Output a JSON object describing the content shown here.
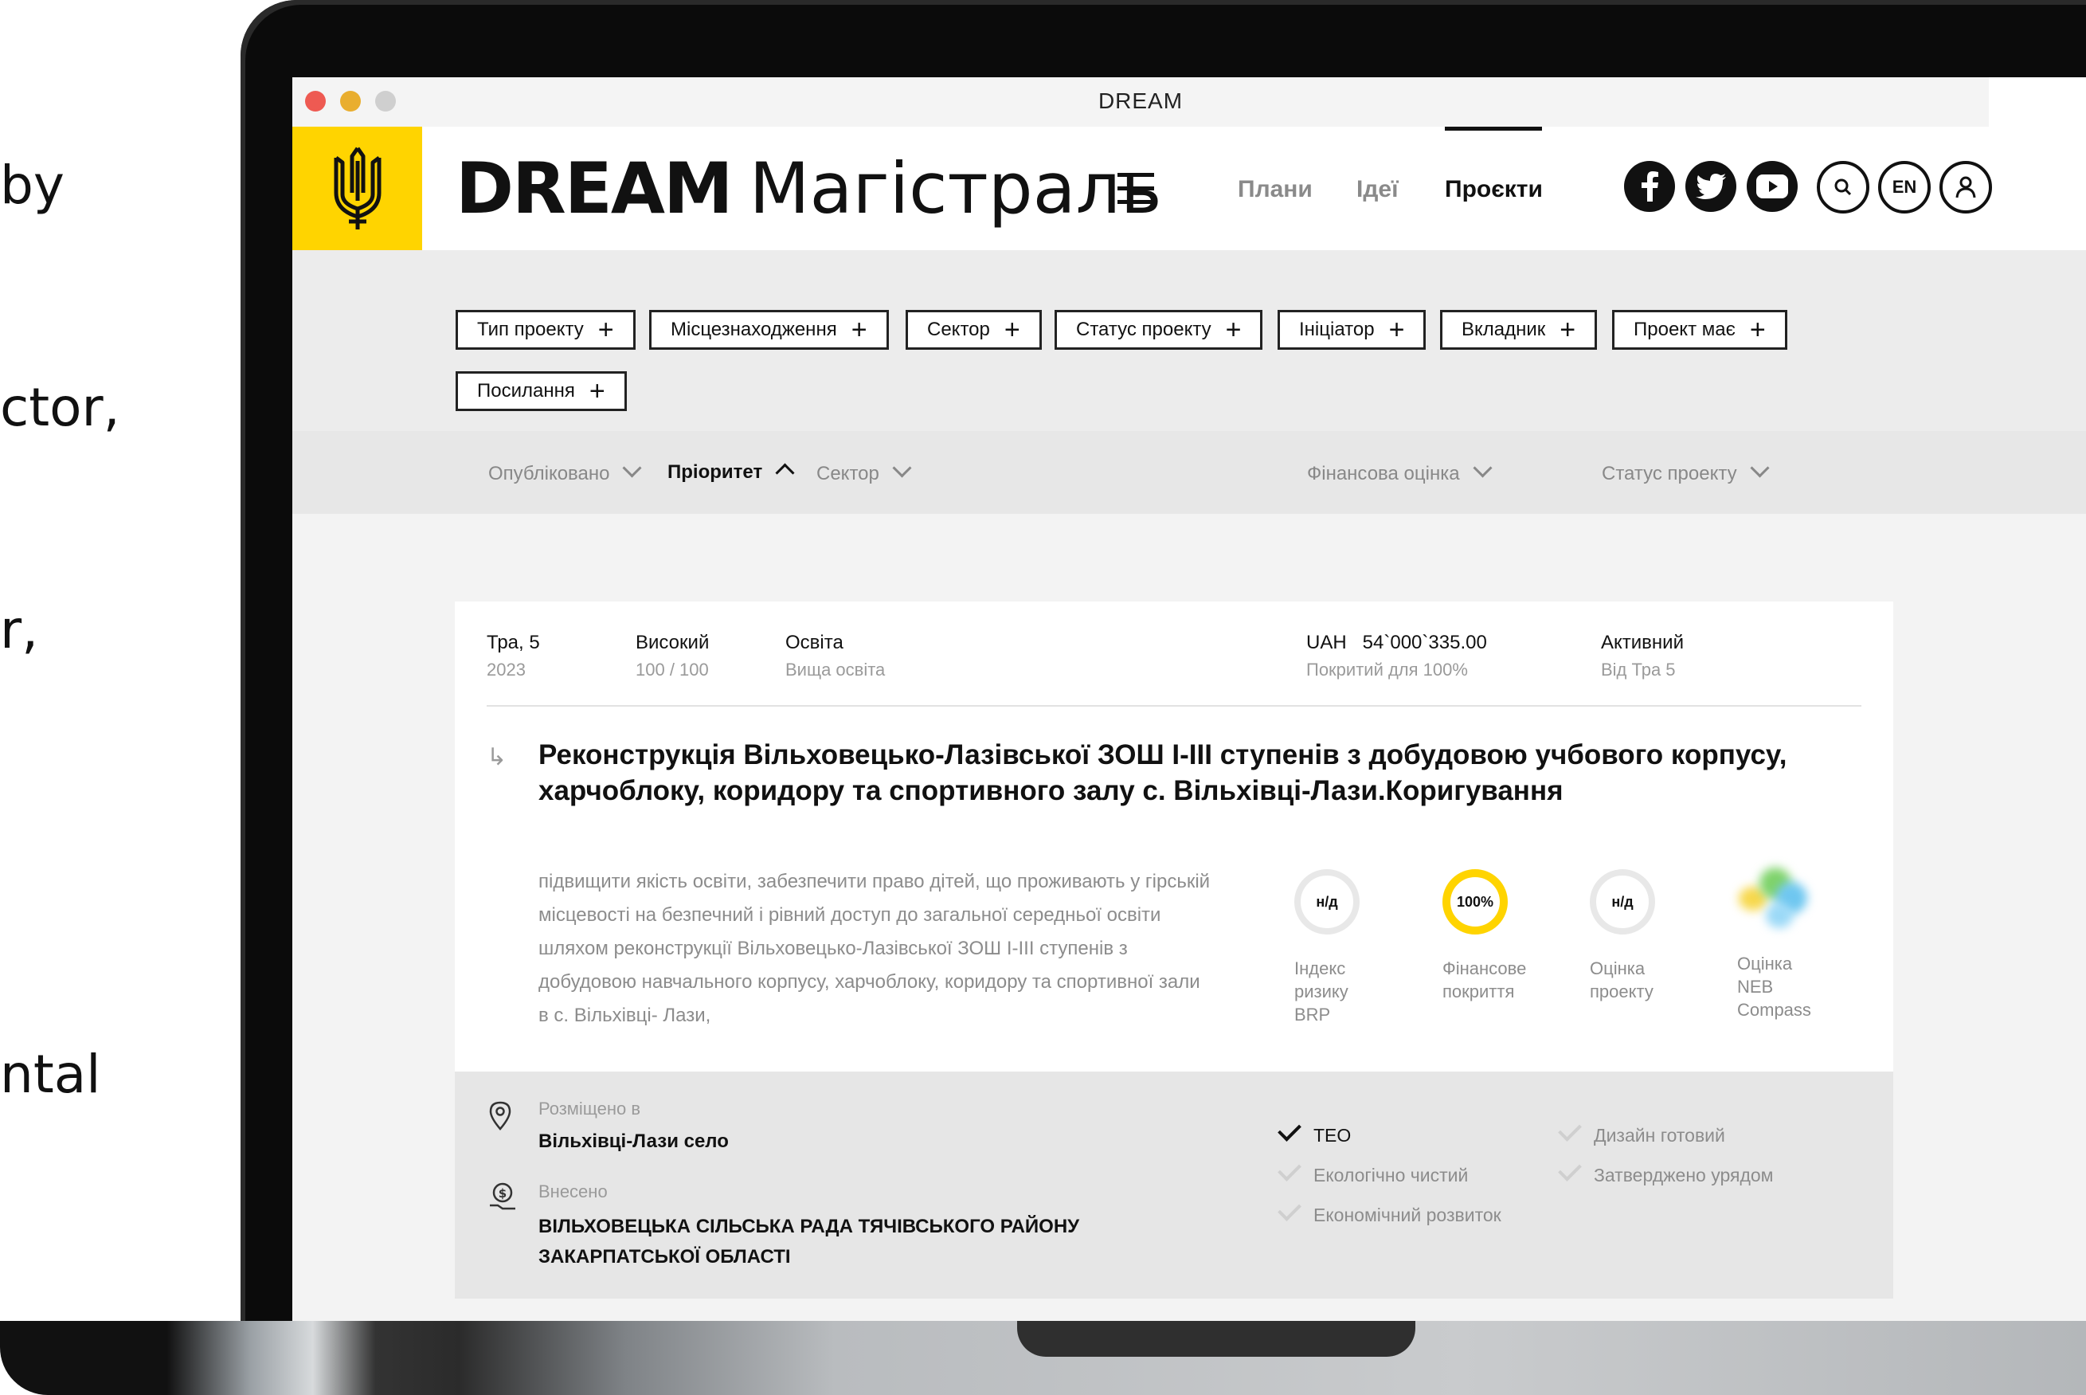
{
  "side_text": [
    "by",
    "ctor,",
    "r,",
    "",
    "ntal"
  ],
  "window": {
    "title": "DREAM"
  },
  "header": {
    "brand_bold": "DREAM",
    "brand_light": "Магістраль",
    "nav": [
      "Плани",
      "Ідеї",
      "Проєкти"
    ],
    "lang": "EN"
  },
  "filters": [
    "Тип проекту",
    "Місцезнаходження",
    "Сектор",
    "Статус проекту",
    "Ініціатор",
    "Вкладник",
    "Проект має",
    "Посилання"
  ],
  "sort": [
    "Опубліковано",
    "Пріоритет",
    "Сектор",
    "Фінансова оцінка",
    "Статус проекту"
  ],
  "project": {
    "date": "Тра, 5",
    "year": "2023",
    "priority": "Високий",
    "priority_score": "100 / 100",
    "sector": "Освіта",
    "subsector": "Вища освіта",
    "amount": "UAH   54`000`335.00",
    "coverage": "Покритий для 100%",
    "status": "Активний",
    "status_since": "Від Тра 5",
    "title": "Реконструкція Вільховецько-Лазівської ЗОШ I-III ступенів з добудовою учбового корпусу, харчоблоку, коридору та спортивного залу с. Вільхівці-Лази.Коригування",
    "description": "підвищити якість освіти, забезпечити право дітей, що проживають у гірській місцевості на безпечний і рівний доступ до загальної середньої освіти шляхом реконструкції Вільховецько-Лазівської ЗОШ I-III ступенів з добудовою навчального корпусу, харчоблоку, коридору та спортивної зали в с. Вільхівці- Лази,",
    "metrics": [
      {
        "value": "н/д",
        "label": "Індекс ризику BRP"
      },
      {
        "value": "100%",
        "label": "Фінансове покриття"
      },
      {
        "value": "н/д",
        "label": "Оцінка проекту"
      },
      {
        "value": "",
        "label": "Оцінка NEB Compass"
      }
    ],
    "location_label": "Розміщено в",
    "location": "Вільхівці-Лази село",
    "submitted_label": "Внесено",
    "submitted_by": "ВІЛЬХОВЕЦЬКА СІЛЬСЬКА РАДА ТЯЧІВСЬКОГО РАЙОНУ ЗАКАРПАТСЬКОЇ ОБЛАСТІ",
    "checks": [
      {
        "label": "ТЕО",
        "done": true
      },
      {
        "label": "Дизайн готовий",
        "done": false
      },
      {
        "label": "Екологічно чистий",
        "done": false
      },
      {
        "label": "Затверджено урядом",
        "done": false
      },
      {
        "label": "Економічний розвиток",
        "done": false
      }
    ]
  },
  "colors": {
    "accent": "#ffd400",
    "text": "#111111",
    "muted": "#8c8c8c"
  }
}
